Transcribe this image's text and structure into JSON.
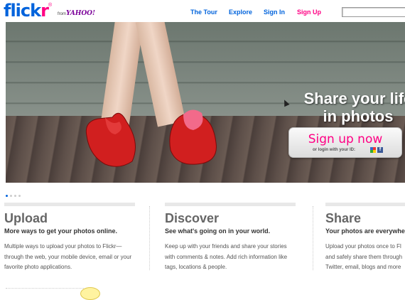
{
  "header": {
    "logo_part1": "flick",
    "logo_part2": "r",
    "logo_reg": "®",
    "logo_from": "from",
    "logo_yahoo": "YAHOO!",
    "nav": [
      {
        "label": "The Tour"
      },
      {
        "label": "Explore"
      },
      {
        "label": "Sign In"
      },
      {
        "label": "Sign Up"
      }
    ],
    "search_value": ""
  },
  "hero": {
    "tagline_line1": "Share your life",
    "tagline_line2": "in photos",
    "cta_label": "Sign up now",
    "login_text": "or login with your ID:",
    "google_icon": "google-icon",
    "facebook_icon": "facebook-icon",
    "facebook_glyph": "f"
  },
  "carousel": {
    "slide_count": 4,
    "active_slide": 1
  },
  "features": [
    {
      "title": "Upload",
      "subtitle": "More ways to get your photos online.",
      "body": "Multiple ways to upload your photos to Flickr—through the web, your mobile device, email or your favorite photo applications."
    },
    {
      "title": "Discover",
      "subtitle": "See what's going on in your world.",
      "body": "Keep up with your friends and share your stories with comments & notes. Add rich information like tags, locations & people."
    },
    {
      "title": "Share",
      "subtitle": "Your photos are everywhe",
      "body": "Upload your photos once to Fl and safely share them through Twitter, email, blogs and more"
    }
  ],
  "colors": {
    "brand_blue": "#0063dc",
    "brand_pink": "#ff0084"
  }
}
